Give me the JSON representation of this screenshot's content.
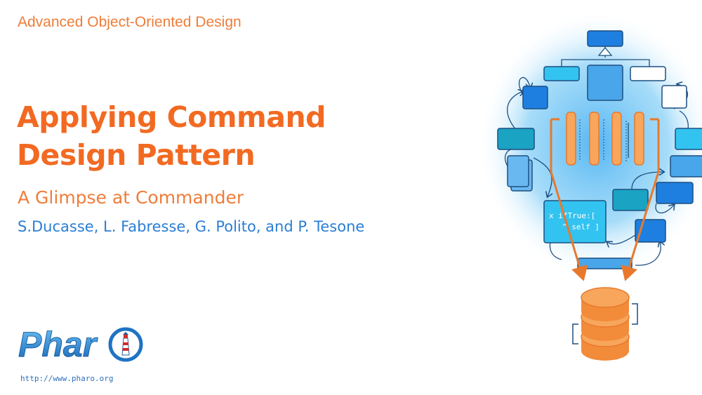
{
  "slide": {
    "course_title": "Advanced Object-Oriented Design",
    "title_line1": "Applying Command",
    "title_line2": "Design Pattern",
    "subtitle": "A Glimpse at Commander",
    "authors": "S.Ducasse, L. Fabresse, G. Polito, and P. Tesone"
  },
  "logo": {
    "text": "Phar",
    "url": "http://www.pharo.org"
  },
  "illustration": {
    "code_line1": "x ifTrue:[",
    "code_line2": "^ self ]"
  },
  "colors": {
    "orange": "#f26a22",
    "blue_text": "#2b7ed4",
    "box_blue": "#1e7fe0",
    "box_cyan": "#33c3f0",
    "box_teal": "#1aa3c3",
    "bulb_orange": "#f7a65c"
  }
}
